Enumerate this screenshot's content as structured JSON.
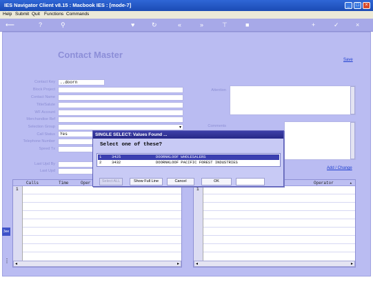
{
  "window": {
    "title": "IES Navigator Client v8.15 : Macbook IES :      [mode-7]"
  },
  "menu": [
    "Help",
    "Submit",
    "Quit",
    "Functions",
    "Commands"
  ],
  "toolbar_icons": [
    "back-arrow-icon",
    "help-icon",
    "search-icon",
    "heart-icon",
    "refresh-icon",
    "rewind-icon",
    "fast-forward-icon",
    "filter-icon",
    "stop-icon",
    "plus-icon",
    "check-icon",
    "close-icon"
  ],
  "form": {
    "heading": "Contact Master",
    "save_link": "Save",
    "labels": [
      "Contact Key",
      "Block Project",
      "Contact Name",
      "Title/Salute",
      "WF Account",
      "Merchandise Ref",
      "Selection Group",
      "Call Status",
      "Telephone Number",
      "Speed Tx",
      "Last Upd By",
      "Last Upd"
    ],
    "contact_key_value": "..doorn",
    "call_status_value": "Yes",
    "attention_label": "Attention",
    "comments_label": "Comments",
    "add_change_link": "Add / Change"
  },
  "grid_left": {
    "columns": [
      "Calls",
      "Time",
      "Oper"
    ],
    "first_row": "1"
  },
  "grid_right": {
    "columns": [
      "Operator"
    ],
    "first_row": "1"
  },
  "dialog": {
    "title": "SINGLE SELECT: Values Found ...",
    "prompt": "Select one of these?",
    "rows": [
      {
        "num": "1",
        "code": "3425",
        "name": "DOORNKLOOF WHOLESALERS",
        "selected": true
      },
      {
        "num": "2",
        "code": "3432",
        "name": "DOORNKLOOF PACIFIC FOREST INDUSTRIES",
        "selected": false
      }
    ],
    "buttons": {
      "select_all": "Select ALL",
      "show_full": "Show Full Line",
      "cancel": "Cancel",
      "ok": "OK"
    }
  },
  "side_label": "3ee",
  "colors": {
    "selected_row": "#3b3fb0",
    "title_blue": "#1b4bb4",
    "panel": "#babcf2"
  }
}
